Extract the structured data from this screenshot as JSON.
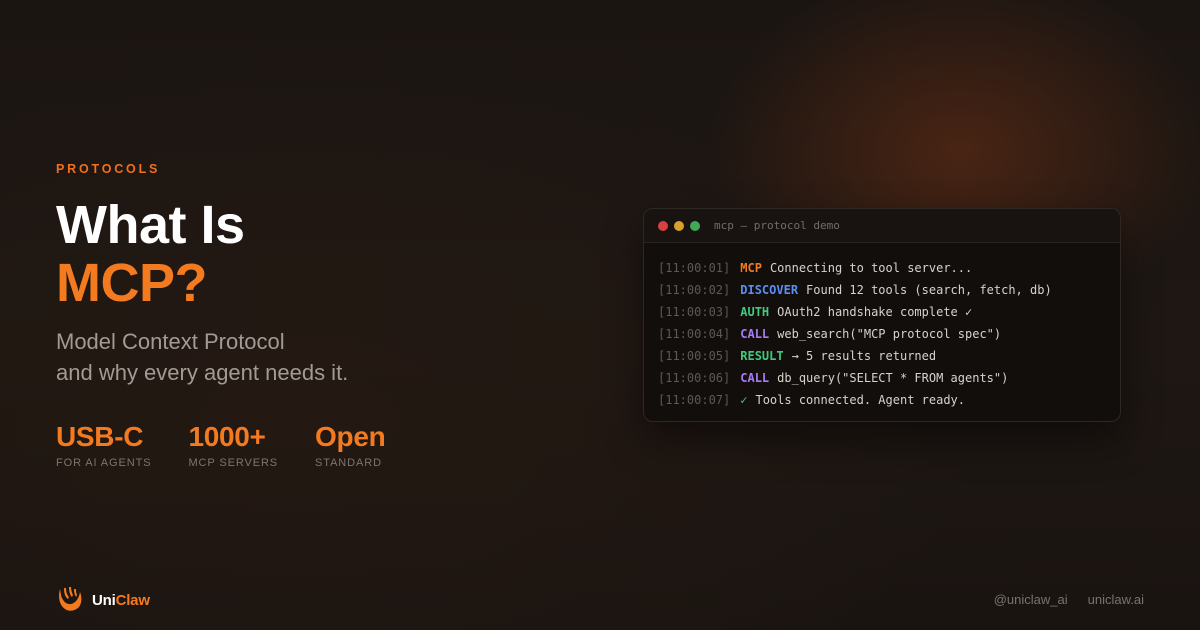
{
  "eyebrow": "PROTOCOLS",
  "title": {
    "line1": "What Is",
    "line2": "MCP?"
  },
  "subtitle": {
    "line1": "Model Context Protocol",
    "line2": "and why every agent needs it."
  },
  "stats": [
    {
      "value": "USB-C",
      "label": "FOR AI AGENTS"
    },
    {
      "value": "1000+",
      "label": "MCP SERVERS"
    },
    {
      "value": "Open",
      "label": "STANDARD"
    }
  ],
  "terminal": {
    "title": "mcp — protocol demo",
    "lines": [
      {
        "time": "[11:00:01]",
        "tag": "MCP",
        "message": "Connecting to tool server..."
      },
      {
        "time": "[11:00:02]",
        "tag": "DISCOVER",
        "message": "Found 12 tools (search, fetch, db)"
      },
      {
        "time": "[11:00:03]",
        "tag": "AUTH",
        "message": "OAuth2 handshake complete ✓"
      },
      {
        "time": "[11:00:04]",
        "tag": "CALL",
        "message": "web_search(\"MCP protocol spec\")"
      },
      {
        "time": "[11:00:05]",
        "tag": "RESULT",
        "message": "→ 5 results returned"
      },
      {
        "time": "[11:00:06]",
        "tag": "CALL",
        "message": "db_query(\"SELECT * FROM agents\")"
      },
      {
        "time": "[11:00:07]",
        "tag": "✓",
        "message": "Tools connected. Agent ready."
      }
    ]
  },
  "brand": {
    "name_part1": "Uni",
    "name_part2": "Claw",
    "logo_icon": "claw-logo-icon"
  },
  "footer": {
    "handle": "@uniclaw_ai",
    "site": "uniclaw.ai"
  },
  "colors": {
    "accent": "#f47a20",
    "discover": "#5b8ff2",
    "success": "#3ecb7e",
    "call": "#a87bf5",
    "background": "#1b1512"
  }
}
